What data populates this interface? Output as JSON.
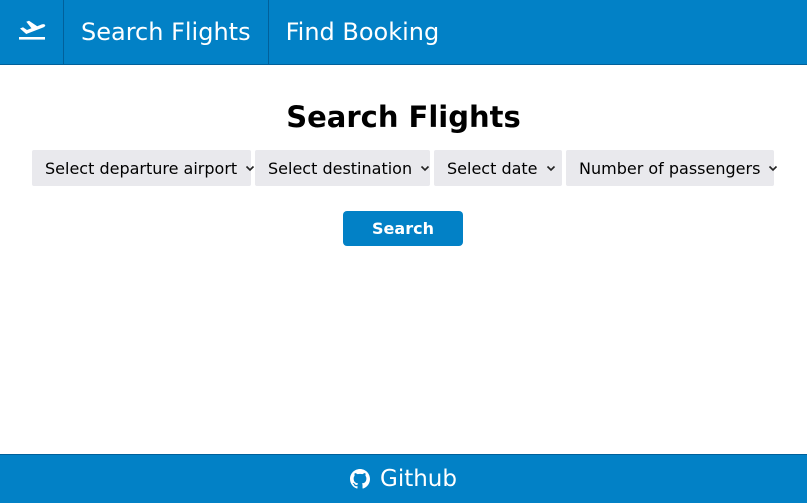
{
  "nav": {
    "brand_icon": "plane-departure-icon",
    "links": [
      {
        "label": "Search Flights"
      },
      {
        "label": "Find Booking"
      }
    ]
  },
  "main": {
    "title": "Search Flights",
    "selects": [
      {
        "placeholder": "Select departure airport"
      },
      {
        "placeholder": "Select destination"
      },
      {
        "placeholder": "Select date"
      },
      {
        "placeholder": "Number of passengers"
      }
    ],
    "search_label": "Search"
  },
  "footer": {
    "icon": "github-icon",
    "link_label": "Github"
  },
  "colors": {
    "brand": "#0281c6",
    "select_bg": "#e9e9ed",
    "text": "#000000",
    "on_brand": "#ffffff"
  }
}
